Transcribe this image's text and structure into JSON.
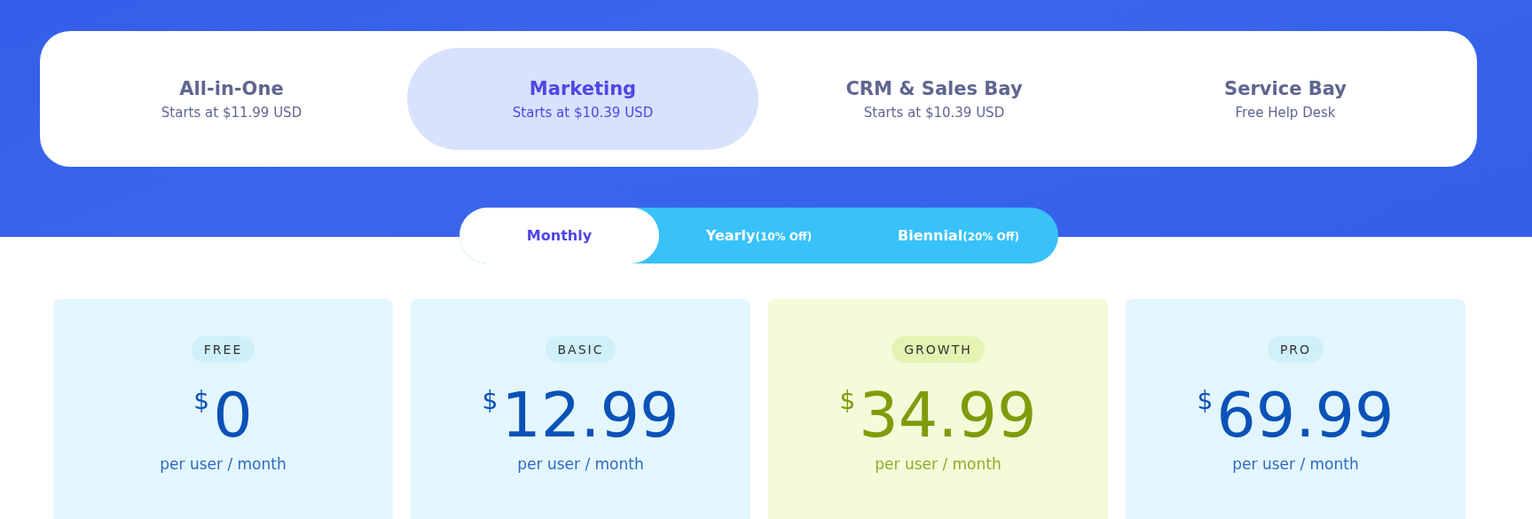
{
  "products": [
    {
      "name": "All-in-One",
      "subtitle": "Starts at $11.99 USD",
      "selected": false
    },
    {
      "name": "Marketing",
      "subtitle": "Starts at $10.39 USD",
      "selected": true
    },
    {
      "name": "CRM & Sales Bay",
      "subtitle": "Starts at $10.39 USD",
      "selected": false
    },
    {
      "name": "Service Bay",
      "subtitle": "Free Help Desk",
      "selected": false
    }
  ],
  "billing": [
    {
      "label": "Monthly",
      "selected": true
    },
    {
      "label": "Yearly",
      "note": "(10% Off)",
      "selected": false
    },
    {
      "label": "Biennial",
      "note": "(20% Off)",
      "selected": false
    }
  ],
  "plans": [
    {
      "badge": "FREE",
      "currency": "$",
      "price": "0",
      "period": "per user / month",
      "featured": false
    },
    {
      "badge": "BASIC",
      "currency": "$",
      "price": "12.99",
      "period": "per user / month",
      "featured": false
    },
    {
      "badge": "GROWTH",
      "currency": "$",
      "price": "34.99",
      "period": "per user / month",
      "featured": true
    },
    {
      "badge": "PRO",
      "currency": "$",
      "price": "69.99",
      "period": "per user / month",
      "featured": false
    }
  ]
}
